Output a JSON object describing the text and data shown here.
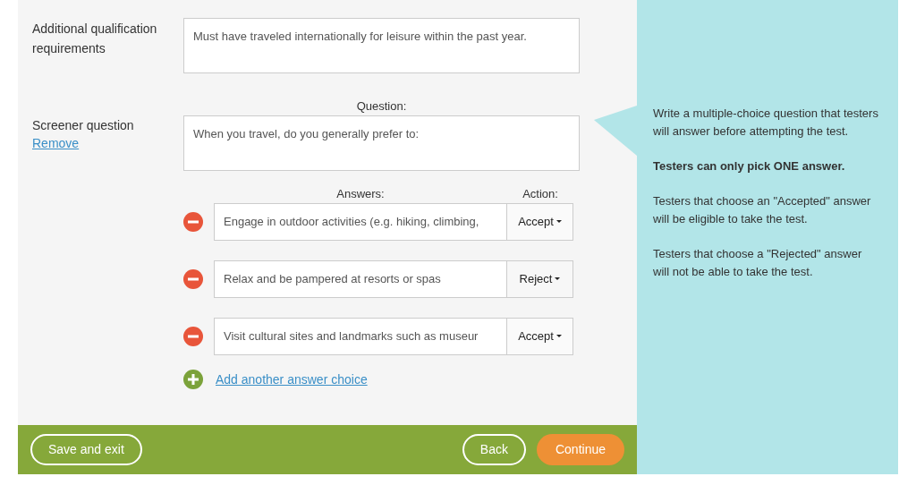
{
  "qualification": {
    "label": "Additional qualification requirements",
    "value": "Must have traveled internationally for leisure within the past year."
  },
  "screener": {
    "label": "Screener question",
    "remove_link": "Remove",
    "question_heading": "Question:",
    "question": "When you travel, do you generally prefer to:",
    "answers_heading": "Answers:",
    "action_heading": "Action:",
    "answers": [
      {
        "text": "Engage in outdoor activities (e.g. hiking, climbing,",
        "action": "Accept"
      },
      {
        "text": "Relax and be pampered at resorts or spas",
        "action": "Reject"
      },
      {
        "text": "Visit cultural sites and landmarks such as museur",
        "action": "Accept"
      }
    ],
    "add_link": "Add another answer choice"
  },
  "help": [
    {
      "kind": "plain",
      "text": "Write a multiple-choice question that testers will answer before attempting the test."
    },
    {
      "kind": "bold",
      "text": "Testers can only pick ONE answer."
    },
    {
      "kind": "plain",
      "text": "Testers that choose an \"Accepted\" answer will be eligible to take the test."
    },
    {
      "kind": "plain",
      "text": "Testers that choose a \"Rejected\" answer will not be able to take the test."
    }
  ],
  "footer": {
    "save": "Save and exit",
    "back": "Back",
    "continue": "Continue"
  }
}
